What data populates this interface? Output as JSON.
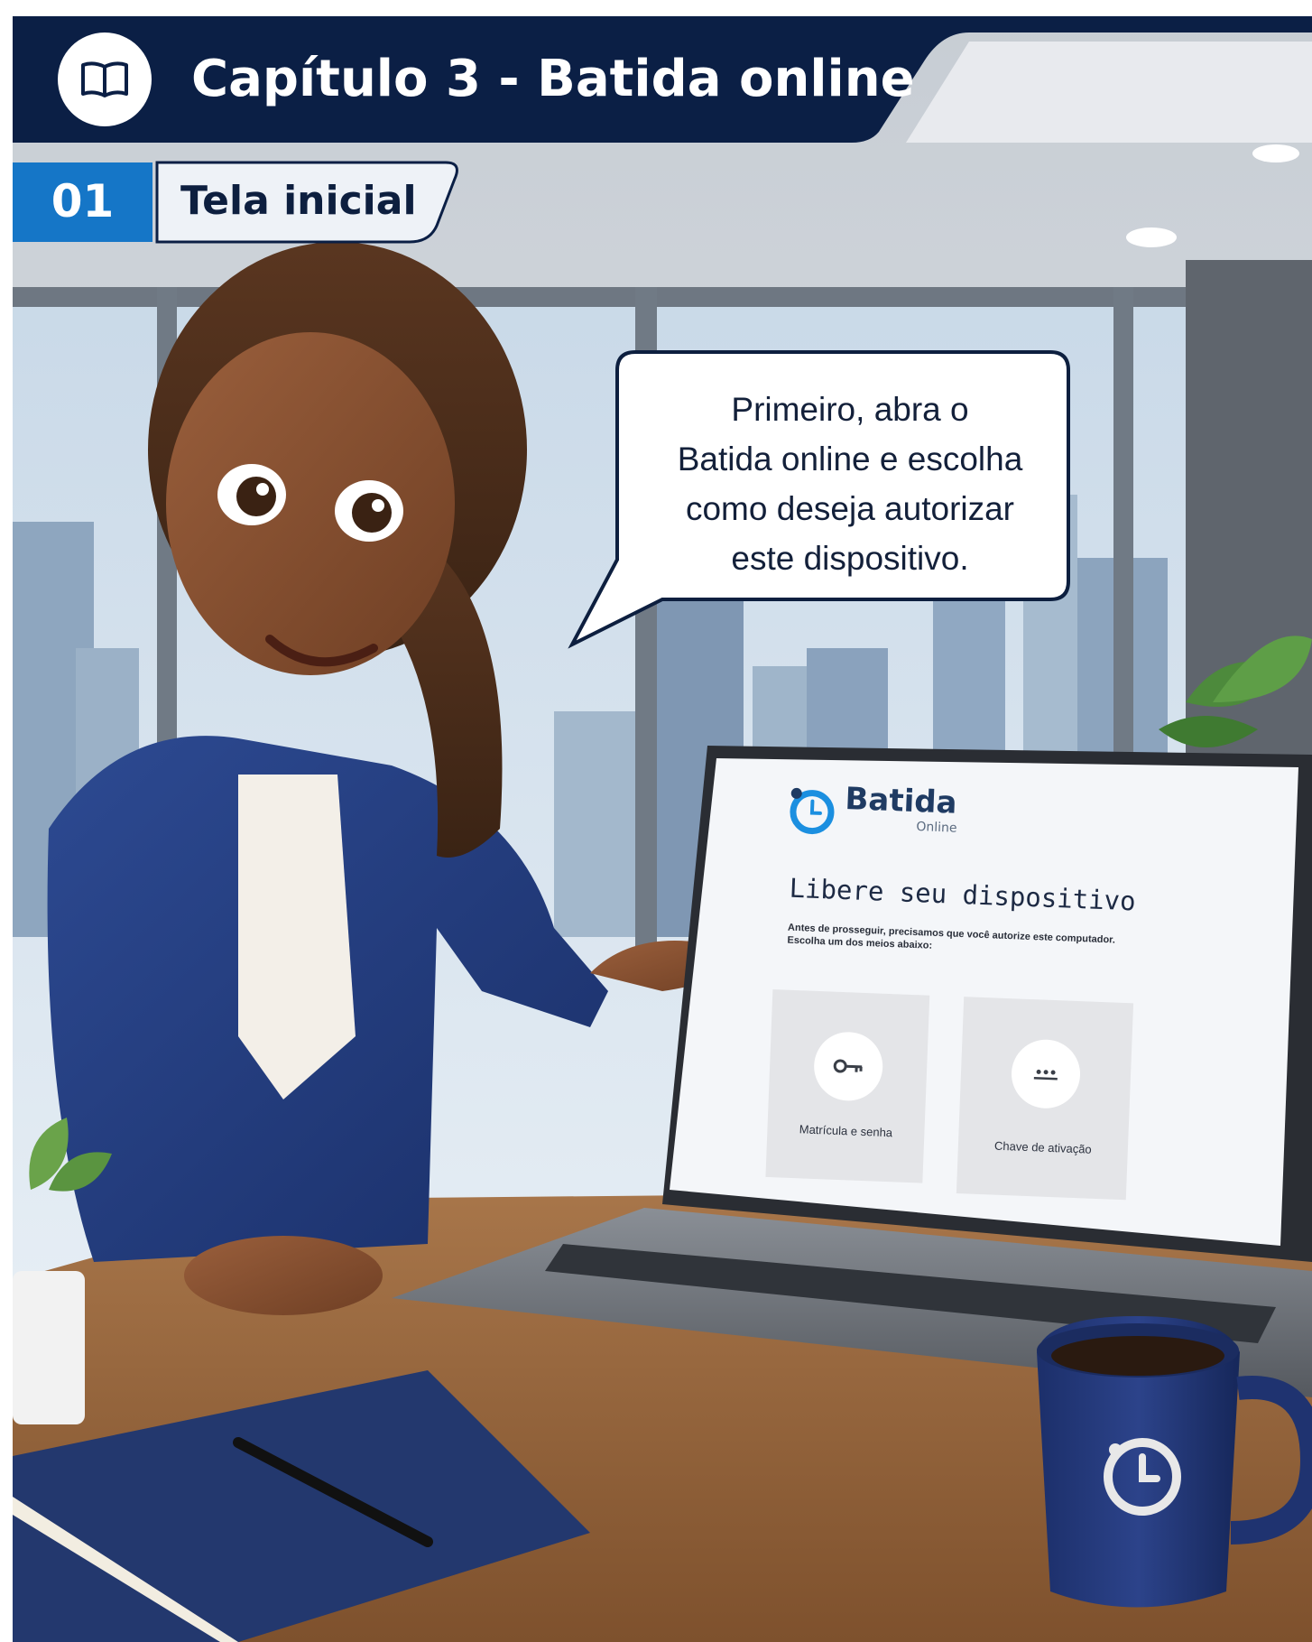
{
  "header": {
    "chapter_icon": "open-book-icon",
    "chapter_title": "Capítulo 3 - Batida online"
  },
  "step": {
    "number": "01",
    "title": "Tela inicial"
  },
  "speech": {
    "lines": [
      "Primeiro, abra o",
      "Batida online e escolha",
      "como deseja autorizar",
      "este dispositivo."
    ]
  },
  "screen": {
    "brand_name": "Batida",
    "brand_sub": "Online",
    "heading": "Libere seu dispositivo",
    "description": "Antes de prosseguir, precisamos que você autorize este computador. Escolha um dos meios abaixo:",
    "options": [
      {
        "label": "Matrícula e senha",
        "icon": "key-icon"
      },
      {
        "label": "Chave de ativação",
        "icon": "password-dots-icon"
      }
    ]
  },
  "colors": {
    "header_navy": "#0b1f45",
    "step_blue": "#1576c7",
    "brand_blue": "#1b8fe0"
  }
}
